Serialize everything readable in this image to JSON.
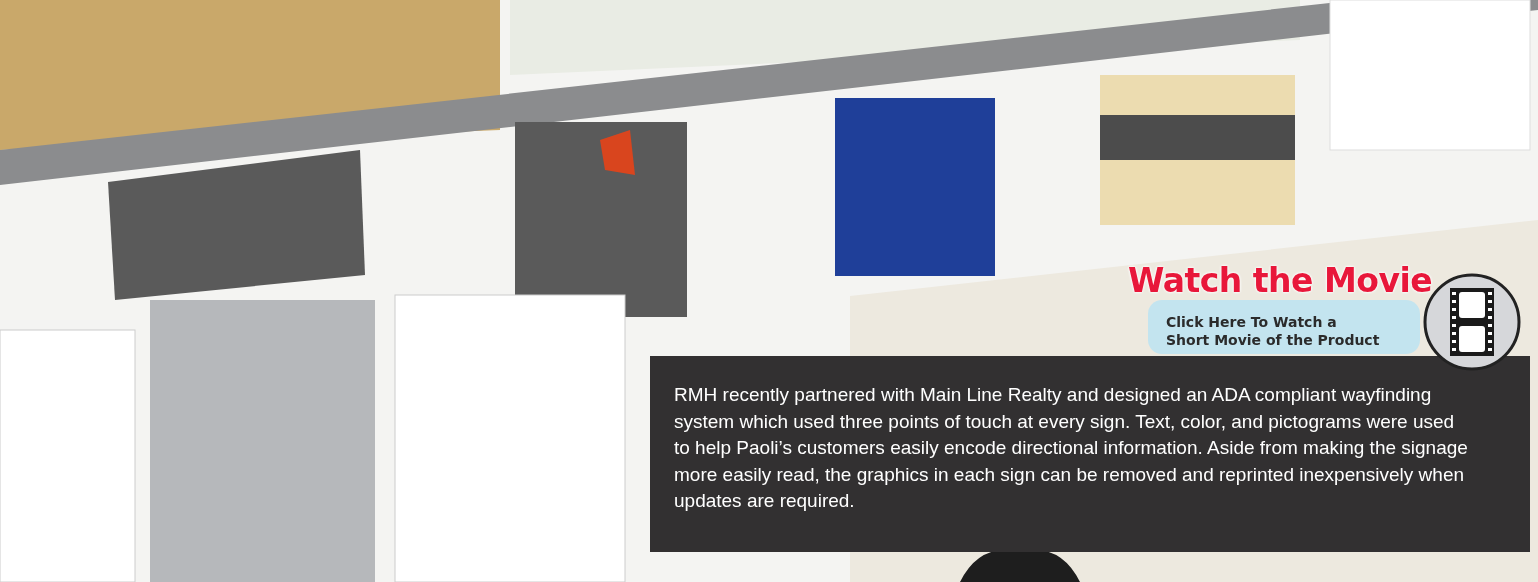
{
  "promo": {
    "title": "Watch the Movie",
    "subtitle": "Click Here To Watch a Short Movie of the Product"
  },
  "description": "RMH recently partnered with Main Line Realty and designed an ADA compliant wayfinding system which used three points of touch at every sign. Text, color, and pictograms were used to help Paoli’s customers easily encode directional information. Aside from making the signage more easily read, the graphics in each sign can be removed and reprinted inexpensively when updates are required."
}
